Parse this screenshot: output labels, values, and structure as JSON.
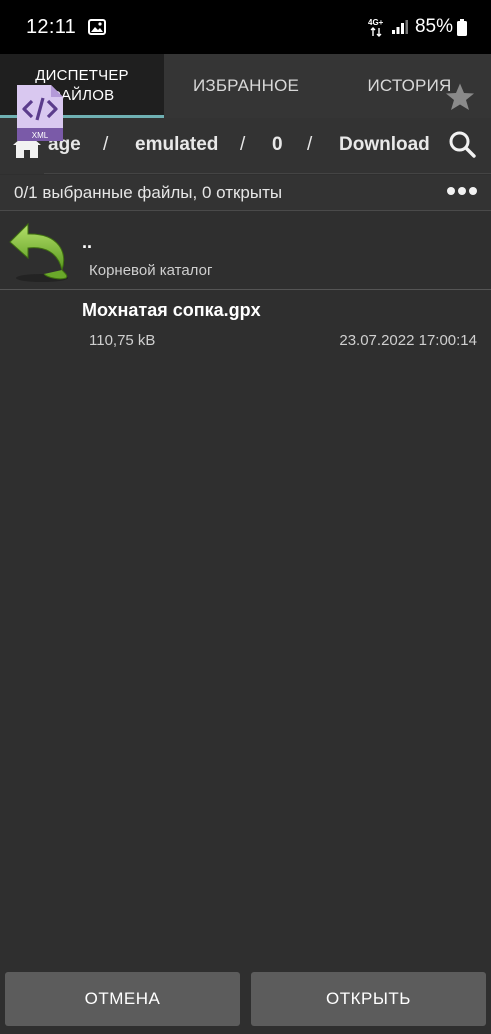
{
  "status_bar": {
    "time": "12:11",
    "network_label": "4G+",
    "battery": "85%"
  },
  "tabs": [
    {
      "label": "ДИСПЕТЧЕР\nФАЙЛОВ",
      "active": true
    },
    {
      "label": "ИЗБРАННОЕ",
      "active": false
    },
    {
      "label": "ИСТОРИЯ",
      "active": false
    }
  ],
  "breadcrumb": {
    "segments": [
      "age",
      "emulated",
      "0",
      "Download"
    ],
    "separator": "/"
  },
  "selection": {
    "text": "0/1 выбранные файлы, 0 открыты"
  },
  "list": {
    "parent": {
      "name": "..",
      "subtitle": "Корневой каталог"
    },
    "files": [
      {
        "name": "Мохнатая сопка.gpx",
        "size": "110,75 kB",
        "modified": "23.07.2022 17:00:14",
        "icon_text": "XML"
      }
    ]
  },
  "buttons": {
    "cancel": "ОТМЕНА",
    "open": "ОТКРЫТЬ"
  },
  "colors": {
    "accent": "#6fb0b3",
    "background": "#2f2f2f",
    "xml_icon": "#d9c8f0",
    "back_arrow": "#8cc63f"
  }
}
